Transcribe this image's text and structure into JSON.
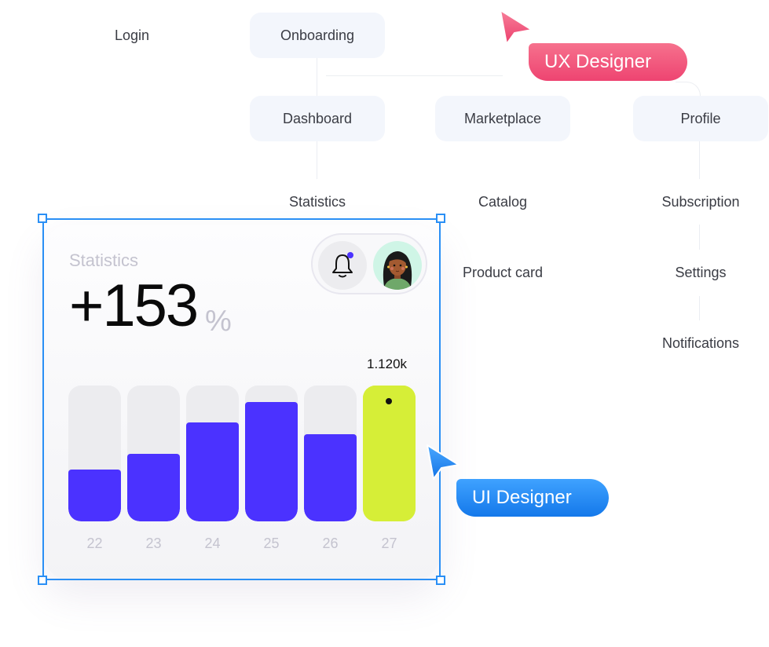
{
  "sitemap": {
    "nodes": {
      "login": "Login",
      "onboarding": "Onboarding",
      "dashboard": "Dashboard",
      "marketplace": "Marketplace",
      "profile": "Profile",
      "statistics": "Statistics",
      "catalog": "Catalog",
      "subscription": "Subscription",
      "product_card": "Product card",
      "settings": "Settings",
      "notifications": "Notifications"
    }
  },
  "stats_card": {
    "title": "Statistics",
    "value": "+153",
    "unit": "%",
    "bell_icon": "bell-icon",
    "notification_dot_color": "#4b32ff",
    "avatar": "user-avatar"
  },
  "collaborators": {
    "ux": {
      "label": "UX Designer",
      "color": "#ef4a75"
    },
    "ui": {
      "label": "UI Designer",
      "color": "#1a82f0"
    }
  },
  "colors": {
    "bar": "#4b32ff",
    "highlight_bar": "#d6ee37",
    "selection": "#2a8ff5"
  },
  "chart_data": {
    "type": "bar",
    "title": "Statistics",
    "categories": [
      "22",
      "23",
      "24",
      "25",
      "26",
      "27"
    ],
    "values": [
      38,
      50,
      73,
      88,
      64,
      100
    ],
    "value_unit": "percent of max",
    "ylim": [
      0,
      100
    ],
    "highlighted_index": 5,
    "highlighted_label": "1.120k",
    "xlabel": "",
    "ylabel": "",
    "grid": false,
    "legend": "none"
  }
}
